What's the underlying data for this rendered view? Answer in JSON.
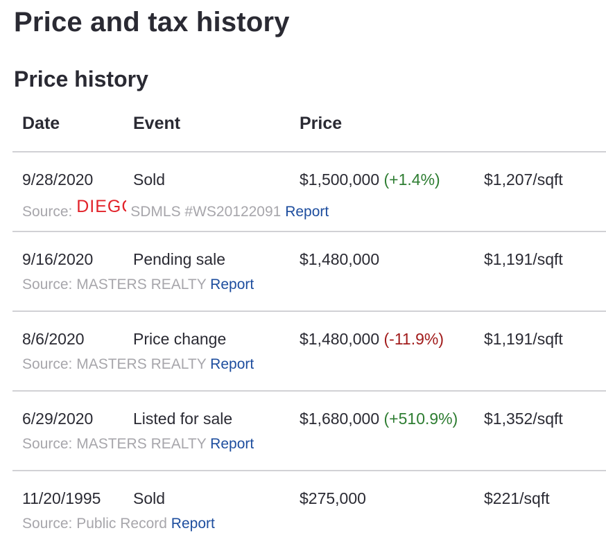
{
  "page": {
    "title": "Price and tax history",
    "subtitle": "Price history"
  },
  "table": {
    "headers": {
      "date": "Date",
      "event": "Event",
      "price": "Price"
    },
    "rows": [
      {
        "date": "9/28/2020",
        "event": "Sold",
        "price": "$1,500,000",
        "change": "(+1.4%)",
        "change_dir": "up",
        "per_sqft": "$1,207/sqft",
        "source_label": "Source:",
        "source_logo": "DIEGC",
        "source_name": "SDMLS #WS20122091",
        "report": "Report"
      },
      {
        "date": "9/16/2020",
        "event": "Pending sale",
        "price": "$1,480,000",
        "change": "",
        "change_dir": "",
        "per_sqft": "$1,191/sqft",
        "source_label": "Source:",
        "source_name": "MASTERS REALTY",
        "report": "Report"
      },
      {
        "date": "8/6/2020",
        "event": "Price change",
        "price": "$1,480,000",
        "change": "(-11.9%)",
        "change_dir": "down",
        "per_sqft": "$1,191/sqft",
        "source_label": "Source:",
        "source_name": "MASTERS REALTY",
        "report": "Report"
      },
      {
        "date": "6/29/2020",
        "event": "Listed for sale",
        "price": "$1,680,000",
        "change": "(+510.9%)",
        "change_dir": "up",
        "per_sqft": "$1,352/sqft",
        "source_label": "Source:",
        "source_name": "MASTERS REALTY",
        "report": "Report"
      },
      {
        "date": "11/20/1995",
        "event": "Sold",
        "price": "$275,000",
        "change": "",
        "change_dir": "",
        "per_sqft": "$221/sqft",
        "source_label": "Source:",
        "source_name": "Public Record",
        "report": "Report"
      }
    ]
  },
  "colors": {
    "positive_change": "#2e7d32",
    "negative_change": "#a11b1b",
    "report_link": "#1d4d9e",
    "source_text": "#a7a6ab",
    "logo": "#e2232a"
  }
}
